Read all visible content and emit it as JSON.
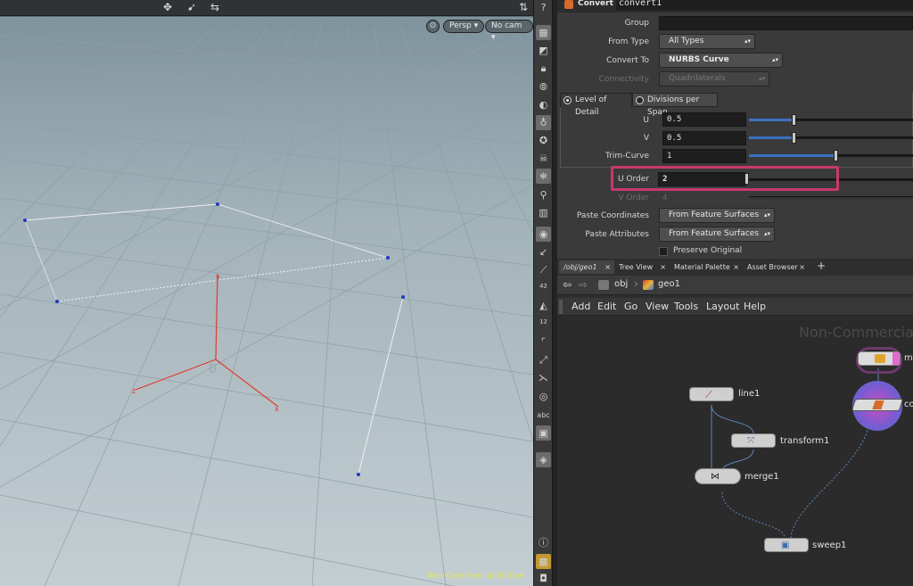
{
  "viewport": {
    "camera_persp": "Persp ▾",
    "camera_cam": "No cam ▾",
    "edition_label": "Non-Commercial Edition",
    "grid_labels": [
      "0",
      "x",
      "z"
    ],
    "tool_icons": [
      "transform-tool-icon",
      "select-tool-icon",
      "handles-tool-icon"
    ],
    "help_icon": "?"
  },
  "params": {
    "node_type": "Convert",
    "node_name": "convert1",
    "group_label": "Group",
    "group_value": "",
    "from_type_label": "From Type",
    "from_type_value": "All Types",
    "convert_to_label": "Convert To",
    "convert_to_value": "NURBS Curve",
    "connectivity_label": "Connectivity",
    "connectivity_value": "Quadrilaterals",
    "tab_lod": "Level of Detail",
    "tab_dps": "Divisions per Span",
    "u_label": "U",
    "u_value": "0.5",
    "v_label": "V",
    "v_value": "0.5",
    "trim_label": "Trim-Curve",
    "trim_value": "1",
    "uorder_label": "U Order",
    "uorder_value": "2",
    "vorder_label": "V Order",
    "vorder_value": "4",
    "paste_coords_label": "Paste Coordinates",
    "paste_coords_value": "From Feature Surfaces",
    "paste_attrs_label": "Paste Attributes",
    "paste_attrs_value": "From Feature Surfaces",
    "preserve_label": "Preserve Original"
  },
  "network": {
    "tabs": [
      {
        "label": "/obj/geo1",
        "close": "×"
      },
      {
        "label": "Tree View",
        "close": "×"
      },
      {
        "label": "Material Palette",
        "close": "×"
      },
      {
        "label": "Asset Browser",
        "close": "×"
      }
    ],
    "add_tab": "+",
    "path": [
      "obj",
      "geo1"
    ],
    "menu": [
      "Add",
      "Edit",
      "Go",
      "View",
      "Tools",
      "Layout",
      "Help"
    ],
    "watermark": "Non-Commercial E",
    "nodes": {
      "line1": "line1",
      "transform1": "transform1",
      "merge1": "merge1",
      "sweep1": "sweep1",
      "m_partial": "m",
      "co_partial": "co"
    }
  },
  "colors": {
    "highlight": "#c8386e",
    "slider_fill": "#3c71c2",
    "edition_text": "#e3e75a",
    "axis_red": "#e03a2c"
  }
}
